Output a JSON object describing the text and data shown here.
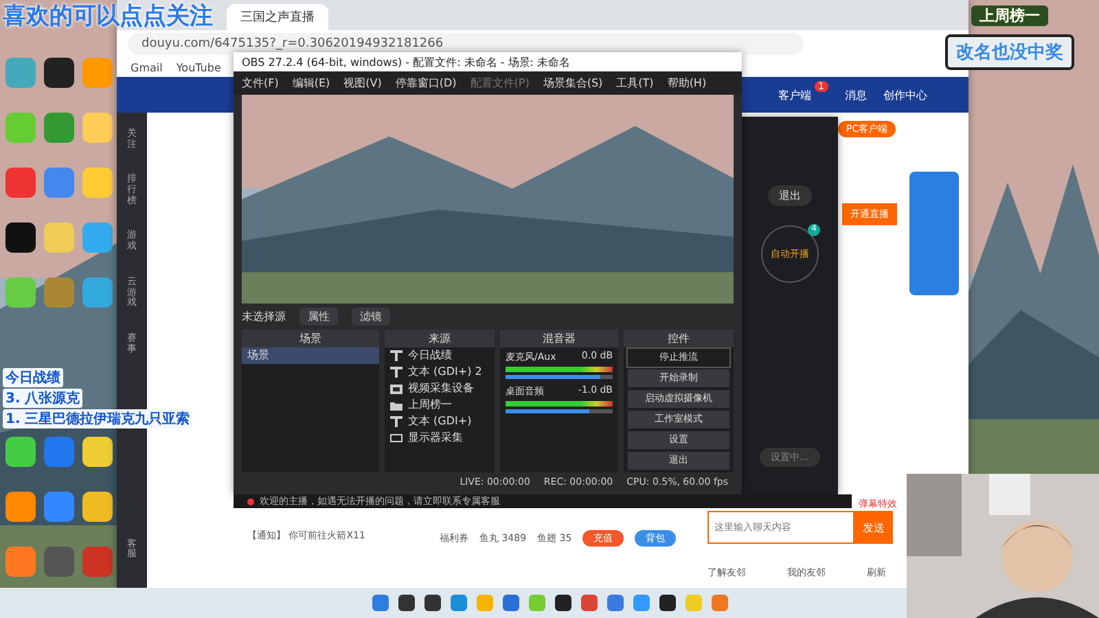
{
  "overlay": {
    "follow_text": "喜欢的可以点点关注",
    "record_title": "今日战绩",
    "record_lines": [
      "3. 八张源克",
      "1. 三星巴德拉伊瑞克九只亚索"
    ],
    "badge_title": "上周榜一",
    "badge_text": "改名也没中奖"
  },
  "browser": {
    "tab": "三国之声直播",
    "address": "douyu.com/6475135?_r=0.30620194932181266",
    "bookmarks": [
      "Gmail",
      "YouTube"
    ],
    "site_nav": [
      {
        "label": "客户端",
        "badge": "1"
      },
      {
        "label": "消息"
      },
      {
        "label": "创作中心"
      }
    ],
    "sidebar": [
      {
        "label": "关注",
        "selected": false
      },
      {
        "label": "排行榜",
        "selected": false
      },
      {
        "label": "游戏",
        "selected": false
      },
      {
        "label": "云游戏",
        "selected": false
      },
      {
        "label": "赛事",
        "selected": false
      },
      {
        "label": "客服",
        "selected": false
      }
    ],
    "client_badge": "PC客户端",
    "open_button": "开通直播",
    "chat_placeholder": "这里输入聊天内容",
    "send": "发送",
    "danmu": "弹幕特效",
    "fans_line": "【通知】 你可前往火箭X11",
    "stats": [
      "福利券",
      "鱼丸 3489",
      "鱼翅 35"
    ],
    "buttons": [
      "充值",
      "背包"
    ],
    "friends": [
      "了解友邻",
      "我的友邻",
      "刷新"
    ]
  },
  "obs": {
    "title": "OBS 27.2.4 (64-bit, windows) - 配置文件: 未命名 - 场景: 未命名",
    "menu": [
      {
        "label": "文件(F)",
        "disabled": false
      },
      {
        "label": "编辑(E)",
        "disabled": false
      },
      {
        "label": "视图(V)",
        "disabled": false
      },
      {
        "label": "停靠窗口(D)",
        "disabled": false
      },
      {
        "label": "配置文件(P)",
        "disabled": true
      },
      {
        "label": "场景集合(S)",
        "disabled": false
      },
      {
        "label": "工具(T)",
        "disabled": false
      },
      {
        "label": "帮助(H)",
        "disabled": false
      }
    ],
    "no_source": "未选择源",
    "props_buttons": [
      "属性",
      "滤镜"
    ],
    "docks": [
      "场景",
      "来源",
      "混音器",
      "控件"
    ],
    "scenes": [
      {
        "label": "场景",
        "selected": true
      }
    ],
    "sources": [
      {
        "label": "今日战绩",
        "kind": "text"
      },
      {
        "label": "文本 (GDI+) 2",
        "kind": "text"
      },
      {
        "label": "视频采集设备",
        "kind": "camera"
      },
      {
        "label": "上周榜一",
        "kind": "folder"
      },
      {
        "label": "文本 (GDI+)",
        "kind": "text"
      },
      {
        "label": "显示器采集",
        "kind": "monitor"
      }
    ],
    "mixer": [
      {
        "name": "麦克风/Aux",
        "reading": "0.0 dB",
        "level": 0.88
      },
      {
        "name": "桌面音频",
        "reading": "-1.0 dB",
        "level": 0.78
      }
    ],
    "controls": [
      {
        "label": "停止推流",
        "selected": true
      },
      {
        "label": "开始录制",
        "selected": false
      },
      {
        "label": "启动虚拟摄像机",
        "selected": false
      },
      {
        "label": "工作室模式",
        "selected": false
      },
      {
        "label": "设置",
        "selected": false
      },
      {
        "label": "退出",
        "selected": false
      }
    ],
    "status": {
      "live": "LIVE: 00:00:00",
      "rec": "REC: 00:00:00",
      "cpu": "CPU: 0.5%, 60.00 fps"
    }
  },
  "assistant": {
    "exit": "退出",
    "auto": "自动开播",
    "count": "4",
    "hint": "设置中...",
    "notice": "欢迎的主播，如遇无法开播的问题，请立即联系专属客服"
  }
}
